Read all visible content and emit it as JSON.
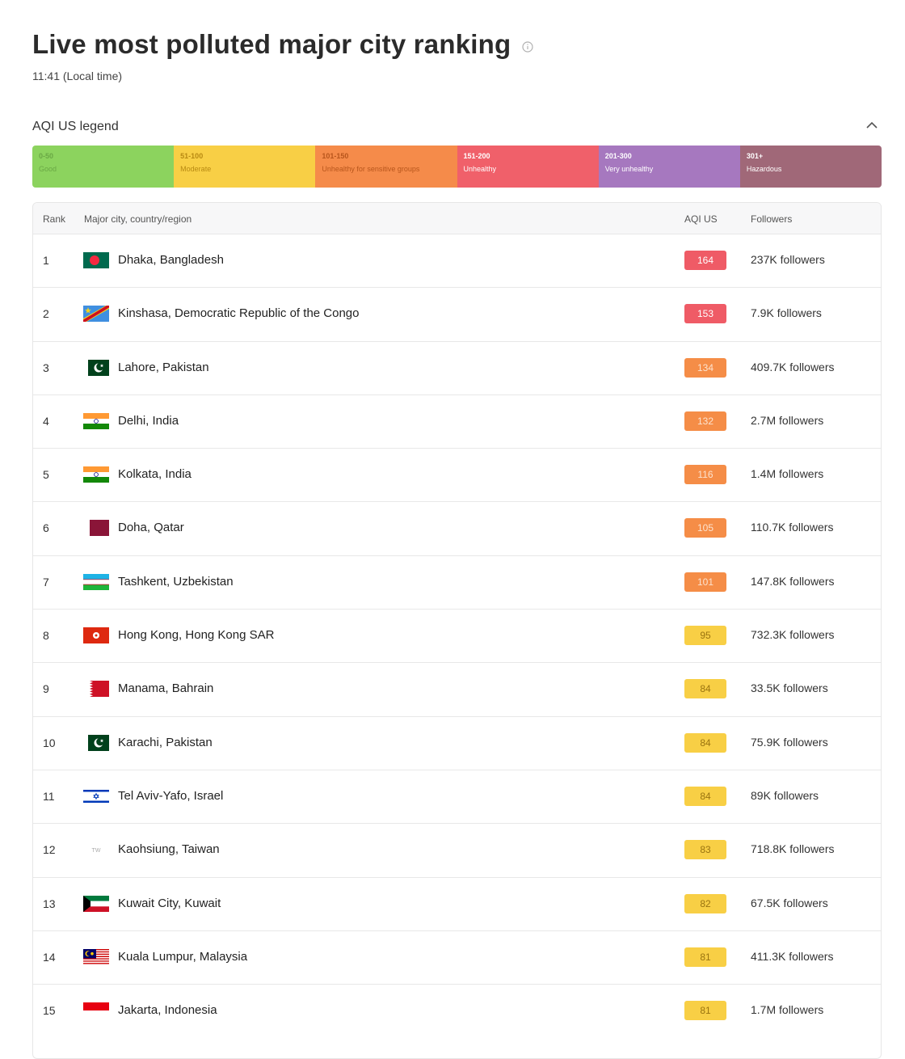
{
  "header": {
    "title": "Live most polluted major city ranking",
    "time": "11:41 (Local time)"
  },
  "legend": {
    "label": "AQI US legend",
    "segments": [
      {
        "range": "0-50",
        "label": "Good",
        "color": "#8cd35e",
        "text_color": "#6aa845"
      },
      {
        "range": "51-100",
        "label": "Moderate",
        "color": "#f8cf45",
        "text_color": "#b88a12"
      },
      {
        "range": "101-150",
        "label": "Unhealthy for sensitive groups",
        "color": "#f58b4a",
        "text_color": "#b8561c"
      },
      {
        "range": "151-200",
        "label": "Unhealthy",
        "color": "#f0606a",
        "text_color": "#ffffff"
      },
      {
        "range": "201-300",
        "label": "Very unhealthy",
        "color": "#a678bf",
        "text_color": "#ffffff"
      },
      {
        "range": "301+",
        "label": "Hazardous",
        "color": "#a06878",
        "text_color": "#ffffff"
      }
    ]
  },
  "table": {
    "headers": {
      "rank": "Rank",
      "city": "Major city, country/region",
      "aqi": "AQI US",
      "followers": "Followers"
    },
    "rows": [
      {
        "rank": "1",
        "city": "Dhaka, Bangladesh",
        "aqi": "164",
        "followers": "237K followers",
        "flag": "bangladesh-flag-icon",
        "level": "unhealthy"
      },
      {
        "rank": "2",
        "city": "Kinshasa, Democratic Republic of the Congo",
        "aqi": "153",
        "followers": "7.9K followers",
        "flag": "drc-flag-icon",
        "level": "unhealthy"
      },
      {
        "rank": "3",
        "city": "Lahore, Pakistan",
        "aqi": "134",
        "followers": "409.7K followers",
        "flag": "pakistan-flag-icon",
        "level": "sensitive"
      },
      {
        "rank": "4",
        "city": "Delhi, India",
        "aqi": "132",
        "followers": "2.7M followers",
        "flag": "india-flag-icon",
        "level": "sensitive"
      },
      {
        "rank": "5",
        "city": "Kolkata, India",
        "aqi": "116",
        "followers": "1.4M followers",
        "flag": "india-flag-icon",
        "level": "sensitive"
      },
      {
        "rank": "6",
        "city": "Doha, Qatar",
        "aqi": "105",
        "followers": "110.7K followers",
        "flag": "qatar-flag-icon",
        "level": "sensitive"
      },
      {
        "rank": "7",
        "city": "Tashkent, Uzbekistan",
        "aqi": "101",
        "followers": "147.8K followers",
        "flag": "uzbekistan-flag-icon",
        "level": "sensitive"
      },
      {
        "rank": "8",
        "city": "Hong Kong, Hong Kong SAR",
        "aqi": "95",
        "followers": "732.3K followers",
        "flag": "hongkong-flag-icon",
        "level": "moderate"
      },
      {
        "rank": "9",
        "city": "Manama, Bahrain",
        "aqi": "84",
        "followers": "33.5K followers",
        "flag": "bahrain-flag-icon",
        "level": "moderate"
      },
      {
        "rank": "10",
        "city": "Karachi, Pakistan",
        "aqi": "84",
        "followers": "75.9K followers",
        "flag": "pakistan-flag-icon",
        "level": "moderate"
      },
      {
        "rank": "11",
        "city": "Tel Aviv-Yafo, Israel",
        "aqi": "84",
        "followers": "89K followers",
        "flag": "israel-flag-icon",
        "level": "moderate"
      },
      {
        "rank": "12",
        "city": "Kaohsiung, Taiwan",
        "aqi": "83",
        "followers": "718.8K followers",
        "flag": "taiwan-flag-icon",
        "flag_text": "TW",
        "level": "moderate"
      },
      {
        "rank": "13",
        "city": "Kuwait City, Kuwait",
        "aqi": "82",
        "followers": "67.5K followers",
        "flag": "kuwait-flag-icon",
        "level": "moderate"
      },
      {
        "rank": "14",
        "city": "Kuala Lumpur, Malaysia",
        "aqi": "81",
        "followers": "411.3K followers",
        "flag": "malaysia-flag-icon",
        "level": "moderate"
      },
      {
        "rank": "15",
        "city": "Jakarta, Indonesia",
        "aqi": "81",
        "followers": "1.7M followers",
        "flag": "indonesia-flag-icon",
        "level": "moderate"
      }
    ]
  },
  "badge_colors": {
    "unhealthy": {
      "bg": "#ef5b66",
      "fg": "#ffffff"
    },
    "sensitive": {
      "bg": "#f58d47",
      "fg": "#fde3cf"
    },
    "moderate": {
      "bg": "#f8cf45",
      "fg": "#9a7410"
    }
  }
}
